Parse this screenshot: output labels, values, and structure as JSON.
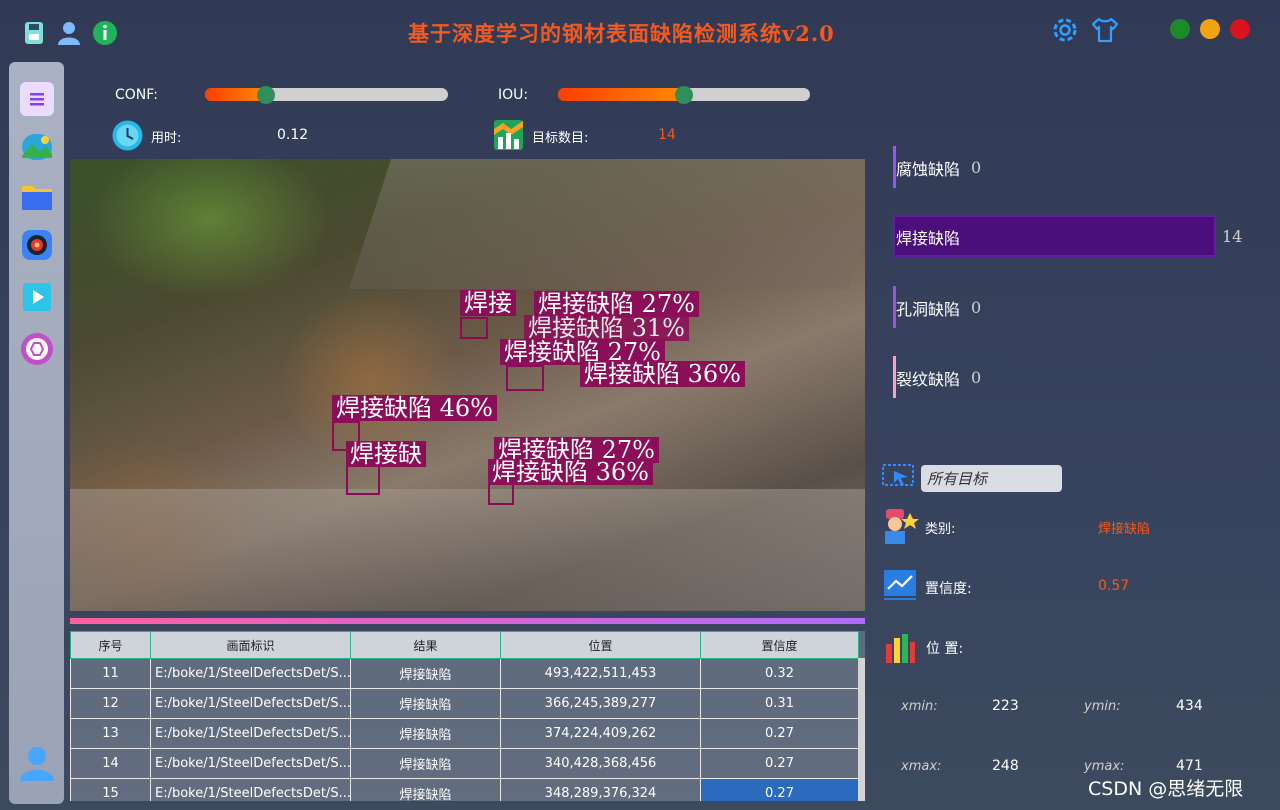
{
  "header": {
    "title": "基于深度学习的钢材表面缺陷检测系统v2.0",
    "left_icons": [
      "save-icon",
      "user-icon",
      "info-icon"
    ],
    "right_icons": [
      "settings-gear-icon",
      "theme-shirt-icon"
    ],
    "window_buttons": {
      "minimize": "#1f8a2a",
      "maximize": "#f2a311",
      "close": "#d9141f"
    }
  },
  "sidebar": {
    "items": [
      "menu-icon",
      "image-icon",
      "folder-icon",
      "camera-icon",
      "video-play-icon",
      "model-icon"
    ],
    "bottom": "user-avatar-icon"
  },
  "controls": {
    "conf_label": "CONF:",
    "conf_value": 0.25,
    "iou_label": "IOU:",
    "iou_value": 0.5,
    "time_label": "用时:",
    "time_value": "0.12",
    "count_label": "目标数目:",
    "count_value": "14"
  },
  "detections": [
    {
      "text": "焊接缺陷  27%"
    },
    {
      "text": "焊接缺陷  31%"
    },
    {
      "text": "焊接缺陷  27%"
    },
    {
      "text": "焊接缺陷  36%"
    },
    {
      "text": "焊接缺陷  46%"
    },
    {
      "text": "焊接缺陷  27%"
    },
    {
      "text": "焊接缺陷  36%"
    }
  ],
  "table": {
    "headers": [
      "序号",
      "画面标识",
      "结果",
      "位置",
      "置信度"
    ],
    "rows": [
      {
        "id": "11",
        "path": "E:/boke/1/SteelDefectsDet/S...",
        "result": "焊接缺陷",
        "pos": "493,422,511,453",
        "conf": "0.32"
      },
      {
        "id": "12",
        "path": "E:/boke/1/SteelDefectsDet/S...",
        "result": "焊接缺陷",
        "pos": "366,245,389,277",
        "conf": "0.31"
      },
      {
        "id": "13",
        "path": "E:/boke/1/SteelDefectsDet/S...",
        "result": "焊接缺陷",
        "pos": "374,224,409,262",
        "conf": "0.27"
      },
      {
        "id": "14",
        "path": "E:/boke/1/SteelDefectsDet/S...",
        "result": "焊接缺陷",
        "pos": "340,428,368,456",
        "conf": "0.27"
      },
      {
        "id": "15",
        "path": "E:/boke/1/SteelDefectsDet/S...",
        "result": "焊接缺陷",
        "pos": "348,289,376,324",
        "conf": "0.27"
      }
    ]
  },
  "class_bars": [
    {
      "label": "腐蚀缺陷",
      "count": "0"
    },
    {
      "label": "焊接缺陷",
      "count": "14"
    },
    {
      "label": "孔洞缺陷",
      "count": "0"
    },
    {
      "label": "裂纹缺陷",
      "count": "0"
    }
  ],
  "details": {
    "filter_value": "所有目标",
    "class_label": "类别:",
    "class_value": "焊接缺陷",
    "conf_label": "置信度:",
    "conf_value": "0.57",
    "pos_label": "位 置:",
    "xmin_label": "xmin:",
    "xmin": "223",
    "ymin_label": "ymin:",
    "ymin": "434",
    "xmax_label": "xmax:",
    "xmax": "248",
    "ymax_label": "ymax:",
    "ymax": "471"
  },
  "watermark": "CSDN @思绪无限"
}
